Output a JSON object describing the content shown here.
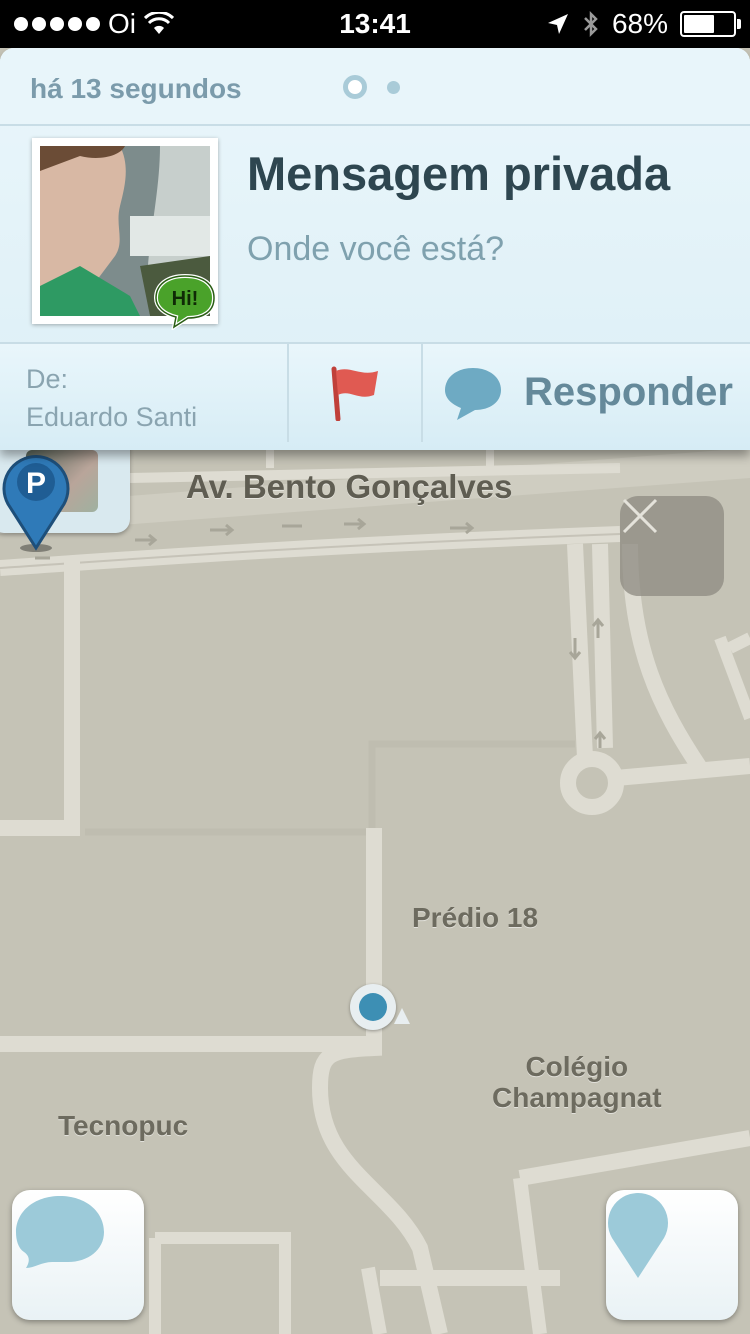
{
  "status_bar": {
    "carrier": "Oi",
    "time": "13:41",
    "battery": "68%",
    "battery_level": 0.68,
    "icons": [
      "signal-dots",
      "wifi-icon",
      "location-arrow-icon",
      "bluetooth-icon",
      "battery-icon"
    ]
  },
  "notification": {
    "time_ago": "há 13 segundos",
    "page_count": 2,
    "current_page": 1,
    "badge": "Hi!",
    "title": "Mensagem privada",
    "message": "Onde você está?",
    "from_label": "De:",
    "from_name": "Eduardo Santi",
    "flag_icon": "flag-icon",
    "reply_label": "Responder",
    "colors": {
      "title": "#2e4650",
      "accent": "#65899a",
      "badge": "#4aa22a",
      "flag": "#e05a52"
    }
  },
  "map": {
    "street_name": "Av. Bento Gonçalves",
    "labels": {
      "predio": "Prédio 18",
      "colegio_line1": "Colégio",
      "colegio_line2": "Champagnat",
      "tecnopuc": "Tecnopuc"
    },
    "parking_letter": "P",
    "colors": {
      "ground": "#c5c3b6",
      "road": "#dedcd2",
      "parking_pin": "#2f7ab8"
    }
  }
}
